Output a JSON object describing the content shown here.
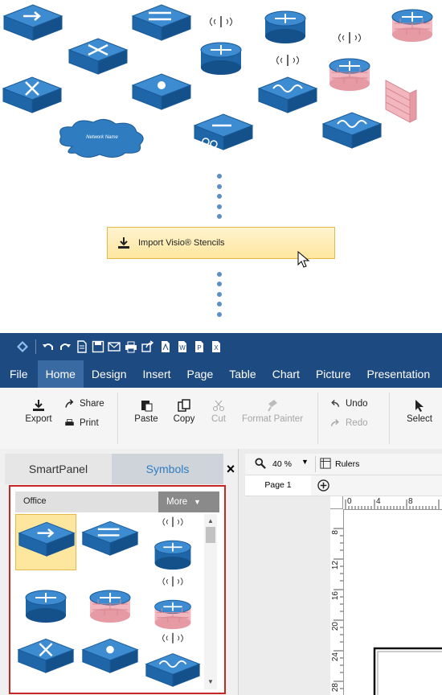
{
  "import_button": {
    "label": "Import Visio® Stencils"
  },
  "cloud": {
    "label": "Network Name"
  },
  "menu": [
    "File",
    "Home",
    "Design",
    "Insert",
    "Page",
    "Table",
    "Chart",
    "Picture",
    "Presentation"
  ],
  "ribbon": {
    "export": "Export",
    "share": "Share",
    "print": "Print",
    "paste": "Paste",
    "copy": "Copy",
    "cut": "Cut",
    "format_painter": "Format Painter",
    "undo": "Undo",
    "redo": "Redo",
    "select": "Select"
  },
  "panel": {
    "tabs": [
      "SmartPanel",
      "Symbols"
    ],
    "close": "×",
    "library": "Office",
    "more": "More"
  },
  "canvas": {
    "zoom": "40 %",
    "rulers": "Rulers",
    "page_tab": "Page 1",
    "ruler_h_labels": [
      "0",
      "4",
      "8"
    ],
    "ruler_v_labels": [
      "8",
      "12",
      "16",
      "20",
      "24",
      "28"
    ]
  },
  "colors": {
    "accent": "#1d4a80",
    "icon_blue": "#2f7cc0",
    "highlight": "#fde69e",
    "panel_border": "#c62828"
  }
}
